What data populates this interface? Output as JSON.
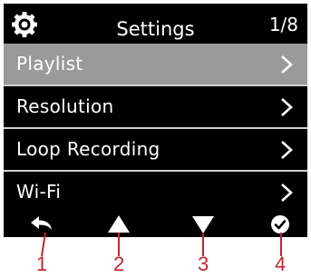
{
  "header": {
    "title": "Settings",
    "page_indicator": "1/8",
    "icon": "gear-icon"
  },
  "menu": {
    "items": [
      {
        "label": "Playlist",
        "selected": true,
        "icon": "chevron-right-icon"
      },
      {
        "label": "Resolution",
        "selected": false,
        "icon": "chevron-right-icon"
      },
      {
        "label": "Loop Recording",
        "selected": false,
        "icon": "chevron-right-icon"
      },
      {
        "label": "Wi-Fi",
        "selected": false,
        "icon": "chevron-right-icon"
      }
    ]
  },
  "toolbar": {
    "buttons": [
      {
        "icon": "back-arrow-icon",
        "callout": "1"
      },
      {
        "icon": "up-triangle-icon",
        "callout": "2"
      },
      {
        "icon": "down-triangle-icon",
        "callout": "3"
      },
      {
        "icon": "check-circle-icon",
        "callout": "4"
      }
    ]
  },
  "colors": {
    "screen_background": "#000000",
    "selected_row": "#9a9a9a",
    "divider": "#cfcfcf",
    "text": "#ffffff",
    "callout": "#c0262d"
  }
}
